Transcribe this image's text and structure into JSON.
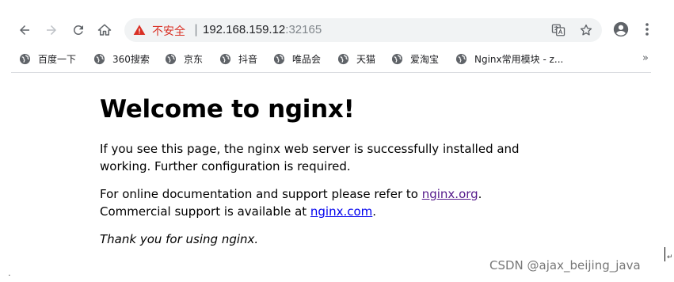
{
  "address_bar": {
    "security_label": "不安全",
    "separator": "|",
    "host": "192.168.159.12",
    "port": ":32165"
  },
  "bookmarks": [
    {
      "label": "百度一下"
    },
    {
      "label": "360搜索"
    },
    {
      "label": "京东"
    },
    {
      "label": "抖音"
    },
    {
      "label": "唯品会"
    },
    {
      "label": "天猫"
    },
    {
      "label": "爱淘宝"
    },
    {
      "label": "Nginx常用模块 - z..."
    }
  ],
  "bookmarks_overflow": "»",
  "page": {
    "heading": "Welcome to nginx!",
    "para1_line1": "If you see this page, the nginx web server is successfully installed and",
    "para1_line2": "working. Further configuration is required.",
    "para2_prefix": "For online documentation and support please refer to ",
    "link_org": "nginx.org",
    "para2_suffix": ".",
    "para2b_prefix": "Commercial support is available at ",
    "link_com": "nginx.com",
    "para2b_suffix": ".",
    "thanks": "Thank you for using nginx."
  },
  "watermark": "CSDN @ajax_beijing_java",
  "icons": {
    "back": "back-arrow-icon",
    "forward": "forward-arrow-icon",
    "reload": "reload-icon",
    "home": "home-icon",
    "warning": "warning-icon",
    "translate": "translate-icon",
    "star": "star-icon",
    "profile": "profile-icon",
    "menu": "menu-kebab-icon",
    "bookmark_favicon": "globe-icon"
  },
  "colors": {
    "insecure_red": "#d93025",
    "link_blue": "#0000ee",
    "link_visited": "#551a8b",
    "omnibox_bg": "#f1f3f4"
  }
}
